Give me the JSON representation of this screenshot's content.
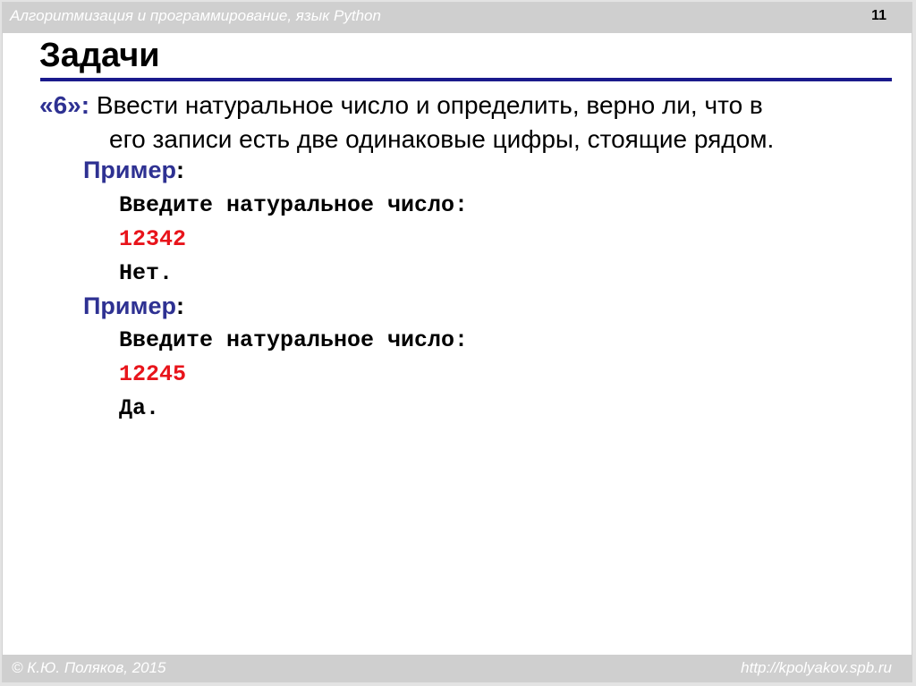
{
  "header": {
    "course_title": "Алгоритмизация и программирование, язык Python",
    "slide_number": "11"
  },
  "title": "Задачи",
  "task": {
    "number": "«6»:",
    "line1": "Ввести натуральное число и определить, верно ли, что в",
    "line2": "его записи есть две одинаковые цифры, стоящие рядом."
  },
  "examples": [
    {
      "label": "Пример",
      "colon": ":",
      "prompt": "Введите натуральное число:",
      "input": "12342",
      "output": "Нет."
    },
    {
      "label": "Пример",
      "colon": ":",
      "prompt": "Введите натуральное число:",
      "input": "12245",
      "output": "Да."
    }
  ],
  "footer": {
    "author": "© К.Ю. Поляков, 2015",
    "site": "http://kpolyakov.spb.ru"
  },
  "colors": {
    "accent_blue": "#2e3192",
    "rule_blue": "#1a1a8c",
    "input_red": "#e8141b",
    "band_gray": "#cfcfcf"
  }
}
